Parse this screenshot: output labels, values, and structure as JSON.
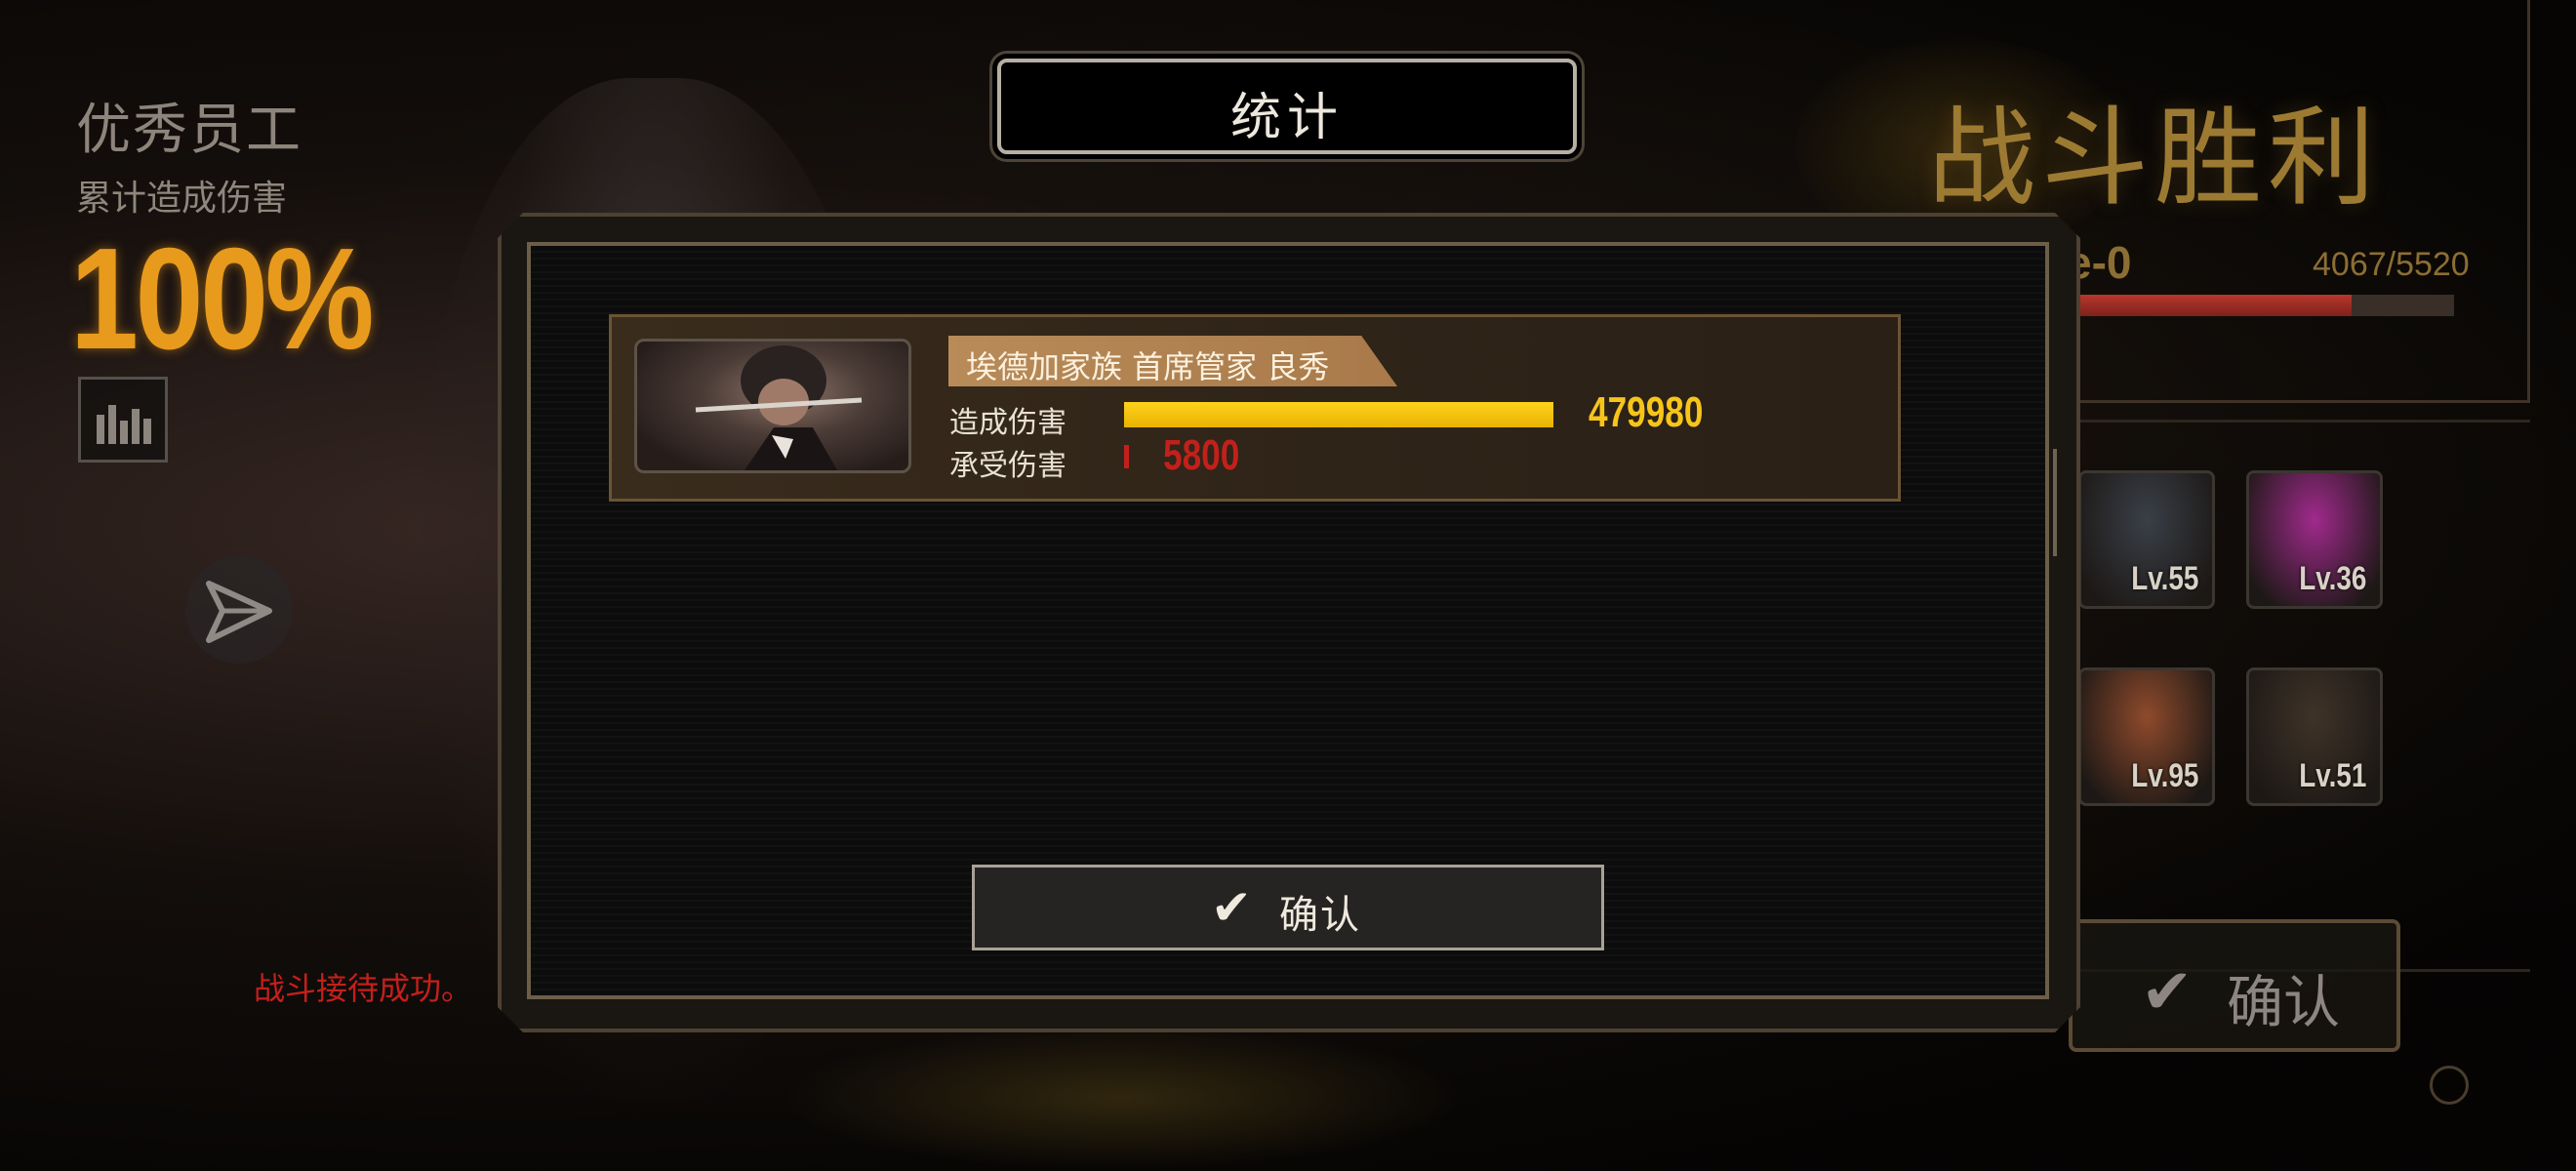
{
  "left_panel": {
    "title": "优秀员工",
    "subtitle": "累计造成伤害",
    "percent": "100%",
    "battle_message": "战斗接待成功。"
  },
  "right_panel": {
    "result_title": "战斗胜利",
    "level_label": "e-0",
    "exp_text": "4067/5520",
    "exp_fraction": 0.737,
    "confirm_label": "确认",
    "team": [
      {
        "level": "Lv.55",
        "tint": "#3a3f48"
      },
      {
        "level": "Lv.36",
        "tint": "#a02a8c"
      },
      {
        "level": "Lv.95",
        "tint": "#8e4a2c"
      },
      {
        "level": "Lv.51",
        "tint": "#3f3328"
      }
    ]
  },
  "stats_modal": {
    "title": "统计",
    "entries": [
      {
        "name": "埃德加家族 首席管家 良秀",
        "damage_dealt_label": "造成伤害",
        "damage_dealt_value": "479980",
        "damage_dealt_fraction": 1.0,
        "damage_taken_label": "承受伤害",
        "damage_taken_value": "5800",
        "damage_taken_fraction": 0.012
      }
    ],
    "confirm_label": "确认"
  },
  "colors": {
    "accent_gold": "#f7c51a",
    "damage_red": "#c3201b",
    "victory_gold": "#9c7a32"
  }
}
